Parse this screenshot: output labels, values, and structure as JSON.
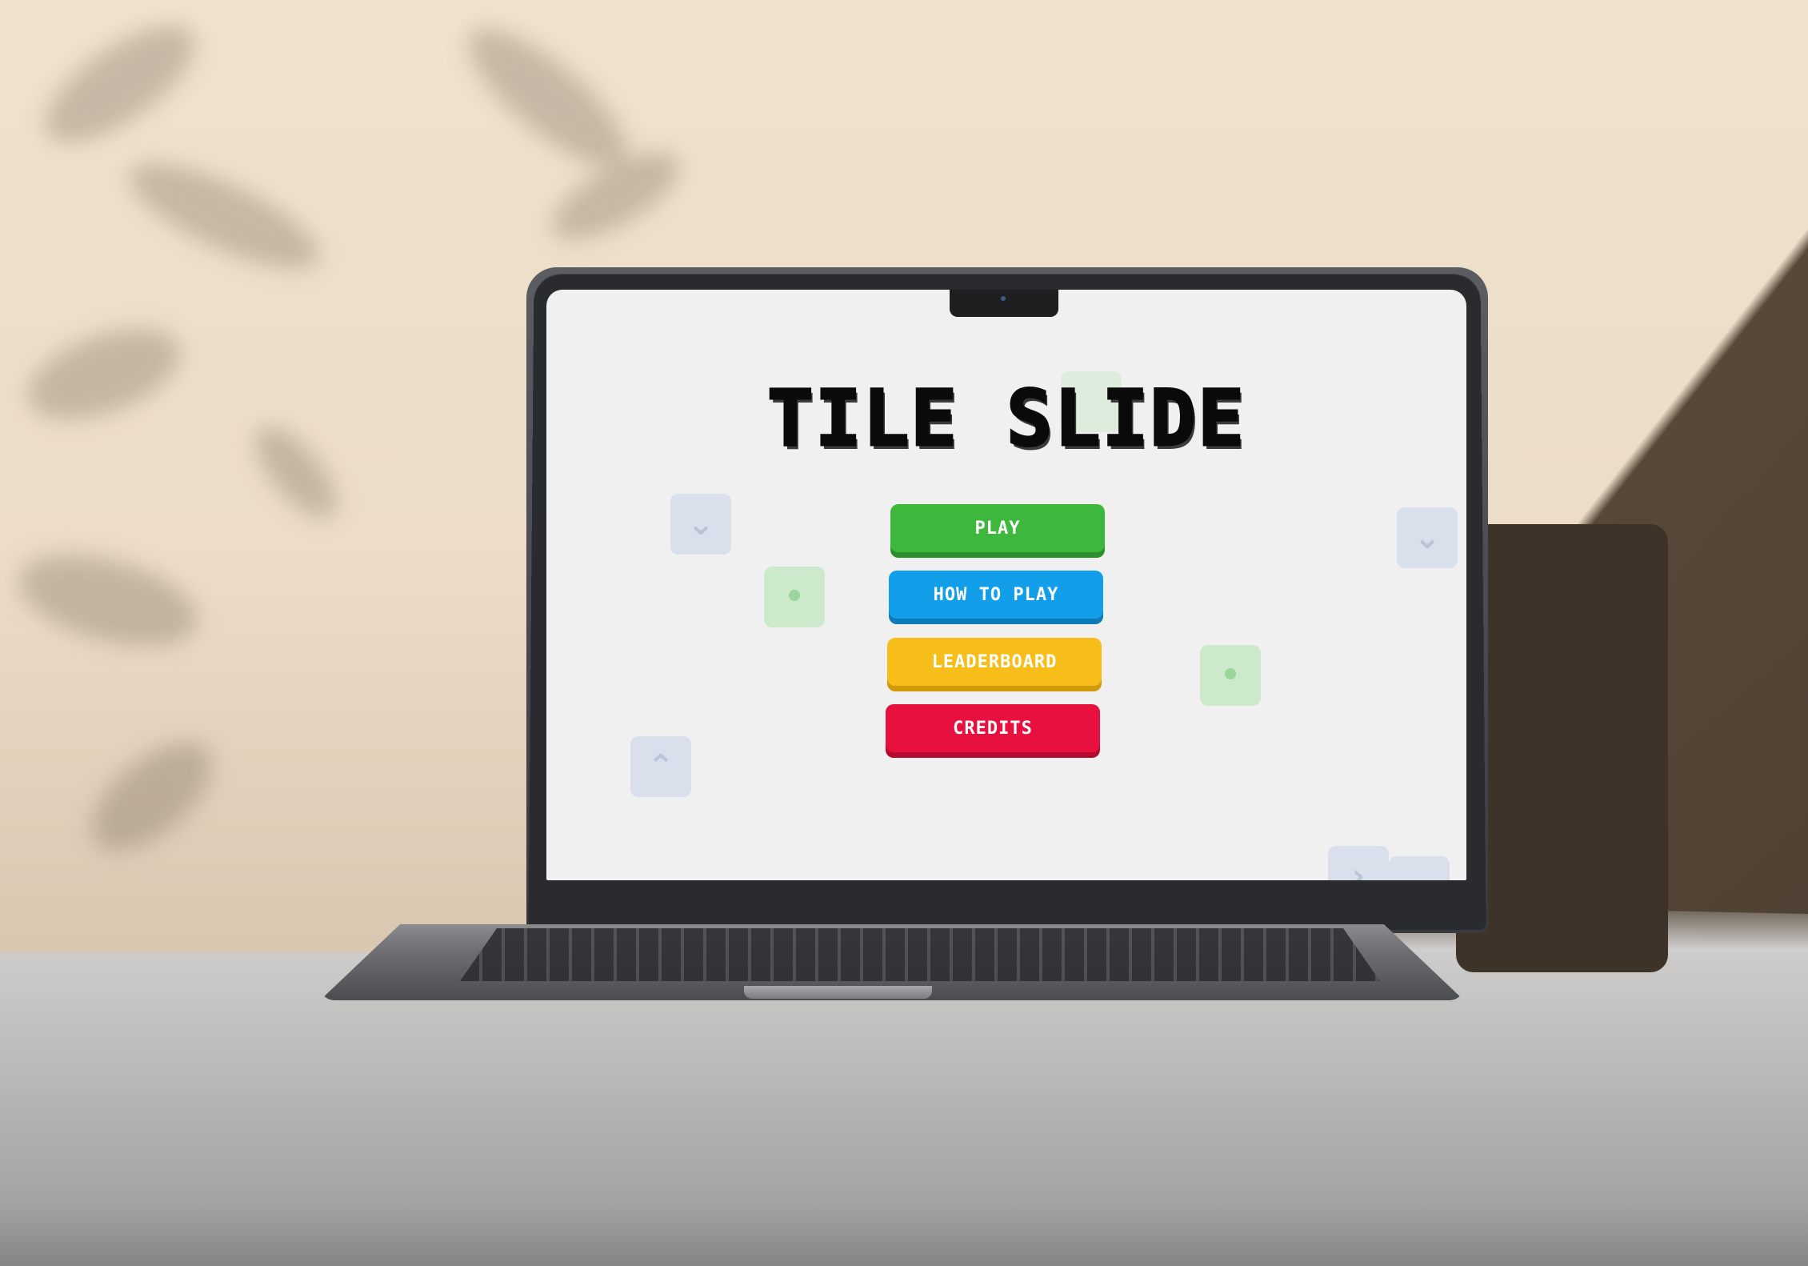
{
  "game": {
    "title": "TILE SLIDE"
  },
  "menu": {
    "play_label": "PLAY",
    "how_to_play_label": "HOW TO PLAY",
    "leaderboard_label": "LEADERBOARD",
    "credits_label": "CREDITS"
  },
  "colors": {
    "play": "#3db83d",
    "how_to_play": "#139eea",
    "leaderboard": "#f7be1a",
    "credits": "#e8103f",
    "screen_background": "#f0f0f0",
    "title": "#0a0a0a"
  },
  "background_tiles": [
    {
      "icon": "chevron-down-icon",
      "glyph": "⌄",
      "color": "blue"
    },
    {
      "icon": "dot-icon",
      "glyph": "•",
      "color": "green"
    },
    {
      "icon": "chevron-up-icon",
      "glyph": "⌃",
      "color": "blue"
    },
    {
      "icon": "dot-icon",
      "glyph": "•",
      "color": "green"
    },
    {
      "icon": "chevron-down-icon",
      "glyph": "⌄",
      "color": "blue"
    },
    {
      "icon": "chevron-right-icon",
      "glyph": "›",
      "color": "blue"
    },
    {
      "icon": "chevron-down-icon",
      "glyph": "⌄",
      "color": "blue"
    },
    {
      "icon": "blank-tile",
      "glyph": "",
      "color": "green"
    }
  ]
}
